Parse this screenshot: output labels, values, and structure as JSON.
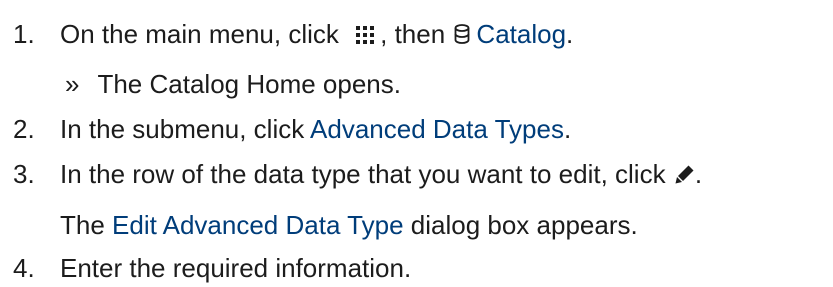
{
  "steps": [
    {
      "number": "1.",
      "before": "On the main menu, click",
      "icon1": "grid-menu-icon",
      "mid": ", then",
      "icon2": "database-icon",
      "ui_label": "Catalog",
      "after": "."
    },
    {
      "bullet": "»",
      "result": "The Catalog Home opens."
    },
    {
      "number": "2.",
      "before": "In the submenu, click",
      "ui_label": "Advanced Data Types",
      "after": "."
    },
    {
      "number": "3.",
      "before": "In the row of the data type that you want to edit, click",
      "icon": "pencil-icon",
      "after": "."
    },
    {
      "note_ui_label": "Edit Advanced Data Type",
      "note_after": "dialog box appears."
    },
    {
      "number": "4.",
      "before": "Enter the required information."
    }
  ],
  "colors": {
    "text": "#1c1c1c",
    "ui_label": "#003d7a"
  }
}
